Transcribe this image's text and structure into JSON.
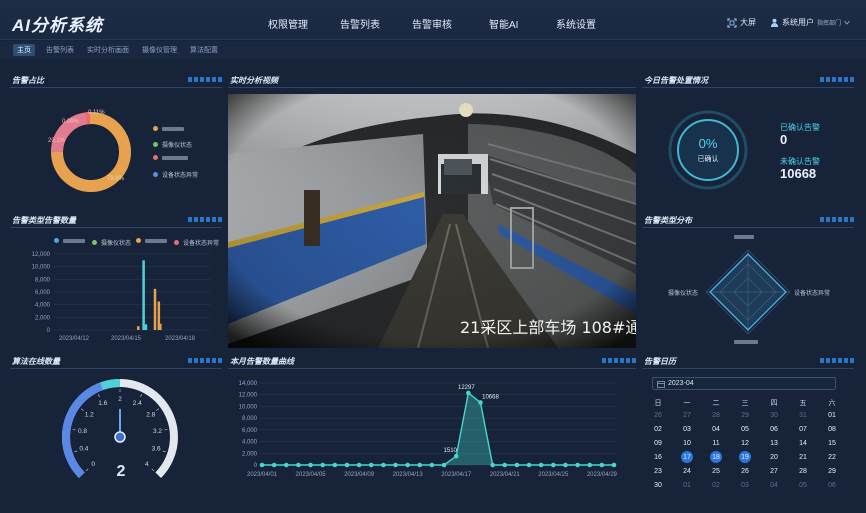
{
  "app": {
    "title": "AI分析系统",
    "nav": [
      "权限管理",
      "告警列表",
      "告警审核",
      "智能AI",
      "系统设置"
    ],
    "screen_label": "大屏",
    "user_label": "系统用户",
    "dept_label": "指挥部门",
    "tabs": [
      "主页",
      "告警列表",
      "实时分析画面",
      "摄像仪管理",
      "算法配置"
    ],
    "active_tab": 0
  },
  "alarm_ratio": {
    "title": "告警占比",
    "slices": [
      {
        "label": "0.11%",
        "color": "#e86d6d",
        "value": 0.11
      },
      {
        "label": "0.09%",
        "color": "#e86d6d",
        "value": 0.09
      },
      {
        "label": "20.1%",
        "color": "#e37a8f",
        "value": 20.1
      },
      {
        "label": "79.8%",
        "color": "#e6a24f",
        "value": 79.8
      }
    ],
    "legend": [
      {
        "label": "",
        "color": "#e6a24f"
      },
      {
        "label": "摄像仪状态",
        "color": "#7cc26b"
      },
      {
        "label": "",
        "color": "#e86d6d"
      },
      {
        "label": "设备状态异常",
        "color": "#5a8fe6"
      }
    ]
  },
  "alarm_type_count": {
    "title": "告警类型告警数量",
    "legend": [
      {
        "label": "",
        "color": "#4fa3e8"
      },
      {
        "label": "摄像仪状态",
        "color": "#7cc26b"
      },
      {
        "label": "",
        "color": "#e6a24f"
      },
      {
        "label": "设备状态异常",
        "color": "#e86d6d"
      }
    ]
  },
  "realtime": {
    "title": "实时分析视频",
    "overlay_text": "21采区上部车场 108#通"
  },
  "today": {
    "title": "今日告警处置情况",
    "percent": "0%",
    "center_label": "已确认",
    "confirmed_label": "已确认告警",
    "confirmed_value": "0",
    "unconfirmed_label": "未确认告警",
    "unconfirmed_value": "10668"
  },
  "type_dist": {
    "title": "告警类型分布",
    "labels": [
      "",
      "设备状态异常",
      "",
      "摄像仪状态"
    ]
  },
  "algo_online": {
    "title": "算法在线数量",
    "ticks": [
      "0",
      "0.4",
      "0.8",
      "1.2",
      "1.6",
      "2",
      "2.4",
      "2.8",
      "3.2",
      "3.6",
      "4"
    ],
    "value": "2",
    "gauge_value": 2,
    "gauge_max": 4
  },
  "monthly": {
    "title": "本月告警数量曲线",
    "point_labels": [
      "1510",
      "12297",
      "10668"
    ]
  },
  "calendar": {
    "title": "告警日历",
    "month_label": "2023-04",
    "weekdays": [
      "日",
      "一",
      "二",
      "三",
      "四",
      "五",
      "六"
    ],
    "rows": [
      [
        "26",
        "27",
        "28",
        "29",
        "30",
        "31",
        "01"
      ],
      [
        "02",
        "03",
        "04",
        "05",
        "06",
        "07",
        "08"
      ],
      [
        "09",
        "10",
        "11",
        "12",
        "13",
        "14",
        "15"
      ],
      [
        "16",
        "17",
        "18",
        "19",
        "20",
        "21",
        "22"
      ],
      [
        "23",
        "24",
        "25",
        "26",
        "27",
        "28",
        "29"
      ],
      [
        "30",
        "01",
        "02",
        "03",
        "04",
        "05",
        "06"
      ]
    ],
    "highlighted": [
      "17",
      "18",
      "19"
    ]
  },
  "chart_data": [
    {
      "type": "pie",
      "title": "告警占比",
      "labels": [
        "",
        "",
        "",
        ""
      ],
      "values": [
        79.8,
        20.1,
        0.11,
        0.09
      ]
    },
    {
      "type": "bar",
      "title": "告警类型告警数量",
      "categories": [
        "2023/04/12",
        "2023/04/15",
        "2023/04/18"
      ],
      "ylim": [
        0,
        12000
      ],
      "yticks": [
        "0",
        "2,000",
        "4,000",
        "6,000",
        "8,000",
        "10,000",
        "12,000"
      ],
      "bars": [
        {
          "x": 0.83,
          "value": 600,
          "color": "#e6a24f"
        },
        {
          "x": 0.9,
          "value": 11000,
          "color": "#4fd1d9"
        },
        {
          "x": 0.93,
          "value": 900,
          "color": "#4fd1d9"
        },
        {
          "x": 1.05,
          "value": 6500,
          "color": "#e6a24f"
        },
        {
          "x": 1.1,
          "value": 4500,
          "color": "#e6a24f"
        },
        {
          "x": 1.12,
          "value": 1000,
          "color": "#e6a24f"
        }
      ]
    },
    {
      "type": "line",
      "title": "本月告警数量曲线",
      "x": [
        "2023/04/01",
        "2023/04/02",
        "2023/04/03",
        "2023/04/04",
        "2023/04/05",
        "2023/04/06",
        "2023/04/07",
        "2023/04/08",
        "2023/04/09",
        "2023/04/10",
        "2023/04/11",
        "2023/04/12",
        "2023/04/13",
        "2023/04/14",
        "2023/04/15",
        "2023/04/16",
        "2023/04/17",
        "2023/04/18",
        "2023/04/19",
        "2023/04/20",
        "2023/04/21",
        "2023/04/22",
        "2023/04/23",
        "2023/04/24",
        "2023/04/25",
        "2023/04/26",
        "2023/04/27",
        "2023/04/28",
        "2023/04/29",
        "2023/04/30"
      ],
      "xticks": [
        "2023/04/01",
        "2023/04/05",
        "2023/04/09",
        "2023/04/13",
        "2023/04/17",
        "2023/04/21",
        "2023/04/25",
        "2023/04/29"
      ],
      "values": [
        0,
        0,
        0,
        0,
        0,
        0,
        0,
        0,
        0,
        0,
        0,
        0,
        0,
        0,
        0,
        0,
        1510,
        12297,
        10668,
        0,
        0,
        0,
        0,
        0,
        0,
        0,
        0,
        0,
        0,
        0
      ],
      "ylim": [
        0,
        14000
      ],
      "yticks": [
        "0",
        "2,000",
        "4,000",
        "6,000",
        "8,000",
        "10,000",
        "12,000",
        "14,000"
      ]
    }
  ]
}
